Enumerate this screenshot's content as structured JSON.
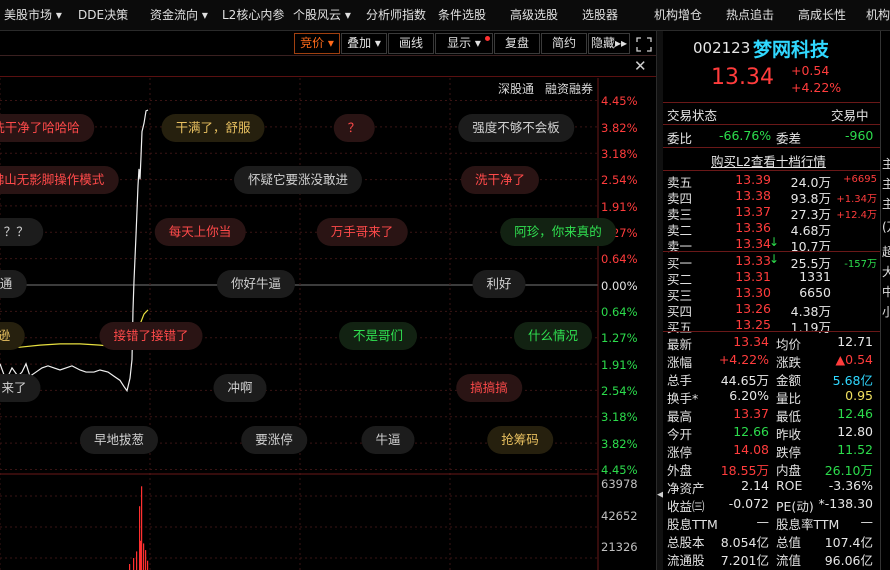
{
  "menubar": {
    "items": [
      "美股市场",
      "DDE决策",
      "资金流向",
      "L2核心内参",
      "个股风云",
      "分析师指数",
      "条件选股",
      "高级选股",
      "选股器",
      "机构增仓",
      "热点追击",
      "高成长性",
      "机构"
    ]
  },
  "toolbar": {
    "buttons": [
      "竞价",
      "叠加",
      "画线",
      "显示",
      "复盘",
      "简约",
      "隐藏"
    ]
  },
  "chart": {
    "top_links": [
      "深股通",
      "融资融券"
    ],
    "pct_labels_upper": [
      "4.45%",
      "3.82%",
      "3.18%",
      "2.54%",
      "1.91%",
      "1.27%",
      "0.64%"
    ],
    "pct_label_zero": "0.00%",
    "pct_labels_lower": [
      "0.64%",
      "1.27%",
      "1.91%",
      "2.54%",
      "3.18%",
      "3.82%",
      "4.45%"
    ],
    "volume_labels": [
      "63978",
      "42652",
      "21326"
    ],
    "danmaku": [
      {
        "text": "洗干净了哈哈哈",
        "color": "red"
      },
      {
        "text": "干满了，舒服",
        "color": "gold"
      },
      {
        "text": "？",
        "color": "red"
      },
      {
        "text": "强度不够不会板",
        "color": "white"
      },
      {
        "text": "佛山无影脚操作模式",
        "color": "red"
      },
      {
        "text": "怀疑它要涨没敢进",
        "color": "white"
      },
      {
        "text": "洗干净了",
        "color": "red"
      },
      {
        "text": "？？？",
        "color": "white"
      },
      {
        "text": "每天上你当",
        "color": "red"
      },
      {
        "text": "万手哥来了",
        "color": "red"
      },
      {
        "text": "阿珍，你来真的",
        "color": "green"
      },
      {
        "text": "通",
        "color": "white"
      },
      {
        "text": "你好牛逼",
        "color": "white"
      },
      {
        "text": "利好",
        "color": "white"
      },
      {
        "text": "逊",
        "color": "gold"
      },
      {
        "text": "接错了接错了",
        "color": "red"
      },
      {
        "text": "不是哥们",
        "color": "green"
      },
      {
        "text": "什么情况",
        "color": "green"
      },
      {
        "text": "来了",
        "color": "white"
      },
      {
        "text": "冲啊",
        "color": "white"
      },
      {
        "text": "搞搞搞",
        "color": "red"
      },
      {
        "text": "早地拔葱",
        "color": "white"
      },
      {
        "text": "要涨停",
        "color": "white"
      },
      {
        "text": "牛逼",
        "color": "white"
      },
      {
        "text": "抢筹码",
        "color": "gold"
      }
    ]
  },
  "chart_data": {
    "type": "line",
    "ylabel": "",
    "ylim_pct": [
      -4.45,
      4.45
    ],
    "series": [
      {
        "points": [
          [
            0,
            -1.9
          ],
          [
            3,
            -2.1
          ],
          [
            6,
            -2.3
          ],
          [
            12,
            -2.0
          ],
          [
            18,
            -2.2
          ],
          [
            22,
            -2.1
          ],
          [
            26,
            -1.9
          ],
          [
            30,
            -2.2
          ],
          [
            36,
            -2.1
          ],
          [
            42,
            -2.0
          ],
          [
            48,
            -1.95
          ],
          [
            54,
            -2.0
          ],
          [
            60,
            -2.05
          ],
          [
            66,
            -2.0
          ],
          [
            72,
            -1.95
          ],
          [
            80,
            -2.05
          ],
          [
            86,
            -2.1
          ],
          [
            94,
            -2.1
          ],
          [
            100,
            -2.05
          ],
          [
            108,
            -2.1
          ],
          [
            114,
            -2.2
          ],
          [
            120,
            -2.3
          ],
          [
            124,
            -2.45
          ],
          [
            127,
            -2.55
          ],
          [
            130,
            -2.25
          ],
          [
            132,
            -1.8
          ],
          [
            133,
            -0.6
          ],
          [
            134,
            0.1
          ],
          [
            136,
            1.2
          ],
          [
            138,
            2.4
          ],
          [
            139,
            2.8
          ],
          [
            140,
            2.55
          ],
          [
            141,
            3.1
          ],
          [
            142,
            3.7
          ],
          [
            144,
            3.9
          ],
          [
            146,
            4.2
          ],
          [
            148,
            4.22
          ]
        ]
      },
      {
        "points": [
          [
            0,
            -1.55
          ],
          [
            20,
            -1.5
          ],
          [
            40,
            -1.45
          ],
          [
            60,
            -1.42
          ],
          [
            80,
            -1.42
          ],
          [
            100,
            -1.45
          ],
          [
            120,
            -1.5
          ],
          [
            132,
            -1.5
          ],
          [
            134,
            -1.35
          ],
          [
            136,
            -1.2
          ],
          [
            140,
            -0.95
          ],
          [
            144,
            -0.7
          ],
          [
            148,
            -0.6
          ]
        ]
      }
    ],
    "volume": {
      "ylim": [
        0,
        63978
      ],
      "bars": [
        [
          129,
          4500
        ],
        [
          133,
          9000
        ],
        [
          136,
          14000
        ],
        [
          139,
          48000
        ],
        [
          140,
          22000
        ],
        [
          141,
          63000
        ],
        [
          143,
          20000
        ],
        [
          145,
          15000
        ],
        [
          147,
          7000
        ]
      ]
    }
  },
  "quote": {
    "code": "002123",
    "name": "梦网科技",
    "price": "13.34",
    "change": "+0.54",
    "change_pct": "+4.22%",
    "trade_status_label": "交易状态",
    "trade_status": "交易中",
    "weibi_label": "委比",
    "weibi": "-66.76%",
    "weicha_label": "委差",
    "weicha": "-960",
    "l2_link": "购买L2查看十档行情",
    "asks": [
      {
        "label": "卖五",
        "price": "13.39",
        "vol": "24.0万",
        "chg": "+6695"
      },
      {
        "label": "卖四",
        "price": "13.38",
        "vol": "93.8万",
        "chg": "+1.34万"
      },
      {
        "label": "卖三",
        "price": "13.37",
        "vol": "27.3万",
        "chg": "+12.4万"
      },
      {
        "label": "卖二",
        "price": "13.36",
        "vol": "4.68万",
        "chg": ""
      },
      {
        "label": "卖一",
        "price": "13.34",
        "vol": "10.7万",
        "chg": ""
      }
    ],
    "bids": [
      {
        "label": "买一",
        "price": "13.33",
        "vol": "25.5万",
        "chg": "-157万"
      },
      {
        "label": "买二",
        "price": "13.31",
        "vol": "1331",
        "chg": ""
      },
      {
        "label": "买三",
        "price": "13.30",
        "vol": "6650",
        "chg": ""
      },
      {
        "label": "买四",
        "price": "13.26",
        "vol": "4.38万",
        "chg": ""
      },
      {
        "label": "买五",
        "price": "13.25",
        "vol": "1.19万",
        "chg": ""
      }
    ],
    "stats": [
      {
        "l1": "最新",
        "v1": "13.34",
        "c1": "red",
        "l2": "均价",
        "v2": "12.71",
        "c2": "white"
      },
      {
        "l1": "涨幅",
        "v1": "+4.22%",
        "c1": "red",
        "l2": "涨跌",
        "v2": "▲0.54",
        "c2": "red"
      },
      {
        "l1": "总手",
        "v1": "44.65万",
        "c1": "white",
        "l2": "金额",
        "v2": "5.68亿",
        "c2": "cyan"
      },
      {
        "l1": "换手*",
        "v1": "6.20%",
        "c1": "white",
        "l2": "量比",
        "v2": "0.95",
        "c2": "yellow"
      },
      {
        "l1": "最高",
        "v1": "13.37",
        "c1": "red",
        "l2": "最低",
        "v2": "12.46",
        "c2": "green"
      },
      {
        "l1": "今开",
        "v1": "12.66",
        "c1": "green",
        "l2": "昨收",
        "v2": "12.80",
        "c2": "white"
      },
      {
        "l1": "涨停",
        "v1": "14.08",
        "c1": "red",
        "l2": "跌停",
        "v2": "11.52",
        "c2": "green"
      },
      {
        "l1": "外盘",
        "v1": "18.55万",
        "c1": "red",
        "l2": "内盘",
        "v2": "26.10万",
        "c2": "green"
      },
      {
        "l1": "净资产",
        "v1": "2.14",
        "c1": "white",
        "l2": "ROE",
        "v2": "-3.36%",
        "c2": "white"
      },
      {
        "l1": "收益㈢",
        "v1": "-0.072",
        "c1": "white",
        "l2": "PE(动)",
        "v2": "*-138.30",
        "c2": "white"
      },
      {
        "l1": "股息TTM",
        "v1": "—",
        "c1": "white",
        "l2": "股息率TTM",
        "v2": "—",
        "c2": "white"
      },
      {
        "l1": "总股本",
        "v1": "8.054亿",
        "c1": "white",
        "l2": "总值",
        "v2": "107.4亿",
        "c2": "white"
      },
      {
        "l1": "流通股",
        "v1": "7.201亿",
        "c1": "white",
        "l2": "流值",
        "v2": "96.06亿",
        "c2": "white"
      }
    ]
  },
  "edge": {
    "chars": [
      "主",
      "主",
      "主",
      "(万",
      "超",
      "大",
      "中",
      "小"
    ]
  }
}
